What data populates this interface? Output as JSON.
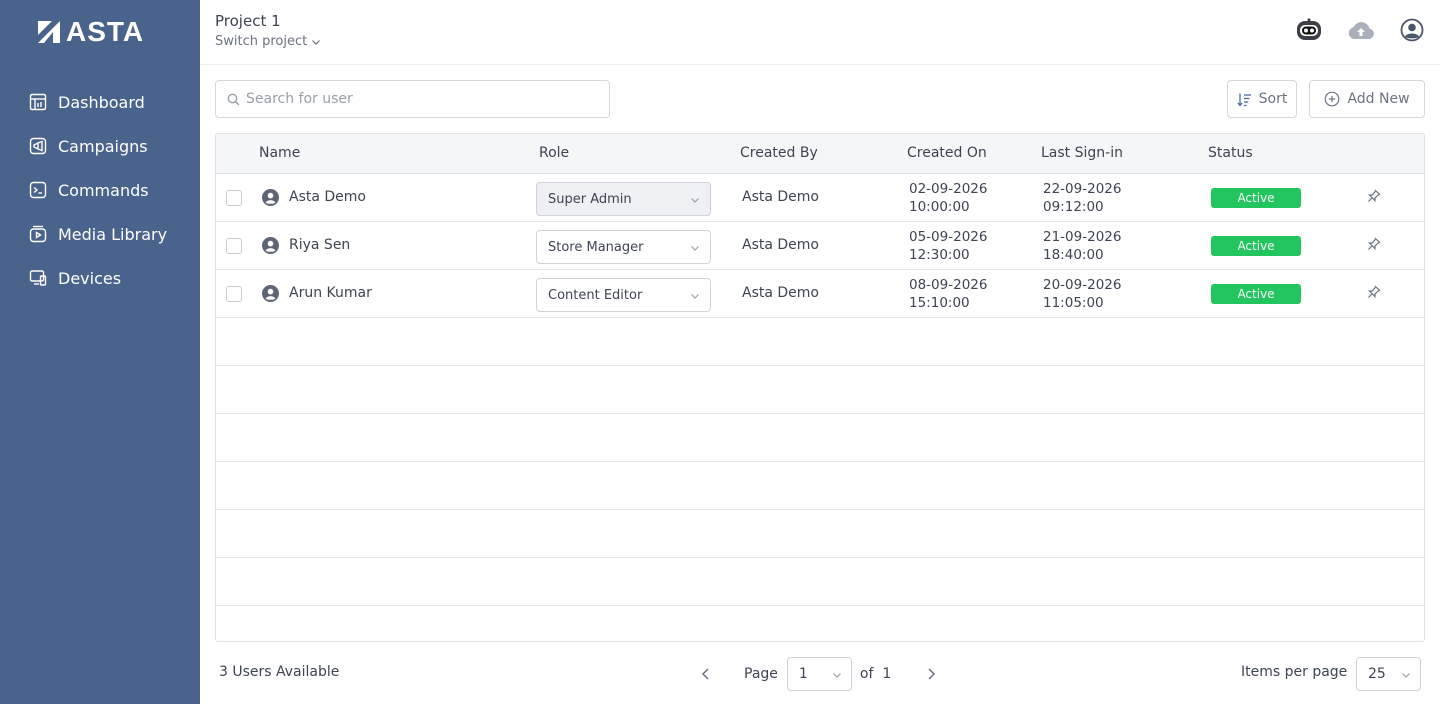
{
  "app": {
    "brand": "ASTA"
  },
  "sidebar": {
    "items": [
      {
        "label": "Dashboard",
        "icon": "dashboard-icon"
      },
      {
        "label": "Campaigns",
        "icon": "campaigns-icon"
      },
      {
        "label": "Commands",
        "icon": "terminal-icon"
      },
      {
        "label": "Media Library",
        "icon": "media-library-icon"
      },
      {
        "label": "Devices",
        "icon": "devices-icon"
      }
    ]
  },
  "header": {
    "project_title": "Project 1",
    "switch_project": "Switch project",
    "icons": [
      "robot-icon",
      "cloud-upload-icon",
      "user-account-icon"
    ]
  },
  "toolbar": {
    "search_placeholder": "Search for user",
    "sort_label": "Sort",
    "add_label": "Add New"
  },
  "table": {
    "columns": [
      "Name",
      "Role",
      "Created By",
      "Created On",
      "Last Sign-in",
      "Status"
    ],
    "rows": [
      {
        "name": "Asta Demo",
        "role": "Super Admin",
        "role_disabled": true,
        "created_by": "Asta Demo",
        "created_on_date": "02-09-2026",
        "created_on_time": "10:00:00",
        "last_signin_date": "22-09-2026",
        "last_signin_time": "09:12:00",
        "status": "Active"
      },
      {
        "name": "Riya Sen",
        "role": "Store Manager",
        "role_disabled": false,
        "created_by": "Asta Demo",
        "created_on_date": "05-09-2026",
        "created_on_time": "12:30:00",
        "last_signin_date": "21-09-2026",
        "last_signin_time": "18:40:00",
        "status": "Active"
      },
      {
        "name": "Arun Kumar",
        "role": "Content Editor",
        "role_disabled": false,
        "created_by": "Asta Demo",
        "created_on_date": "08-09-2026",
        "created_on_time": "15:10:00",
        "last_signin_date": "20-09-2026",
        "last_signin_time": "11:05:00",
        "status": "Active"
      }
    ]
  },
  "footer": {
    "count_text": "3 Users Available",
    "page_label": "Page",
    "page_value": "1",
    "of_label": "of",
    "total_pages": "1",
    "items_per_page_label": "Items per page",
    "items_per_page_value": "25"
  },
  "colors": {
    "sidebar_bg": "#4a638c",
    "status_active": "#22c55e"
  }
}
